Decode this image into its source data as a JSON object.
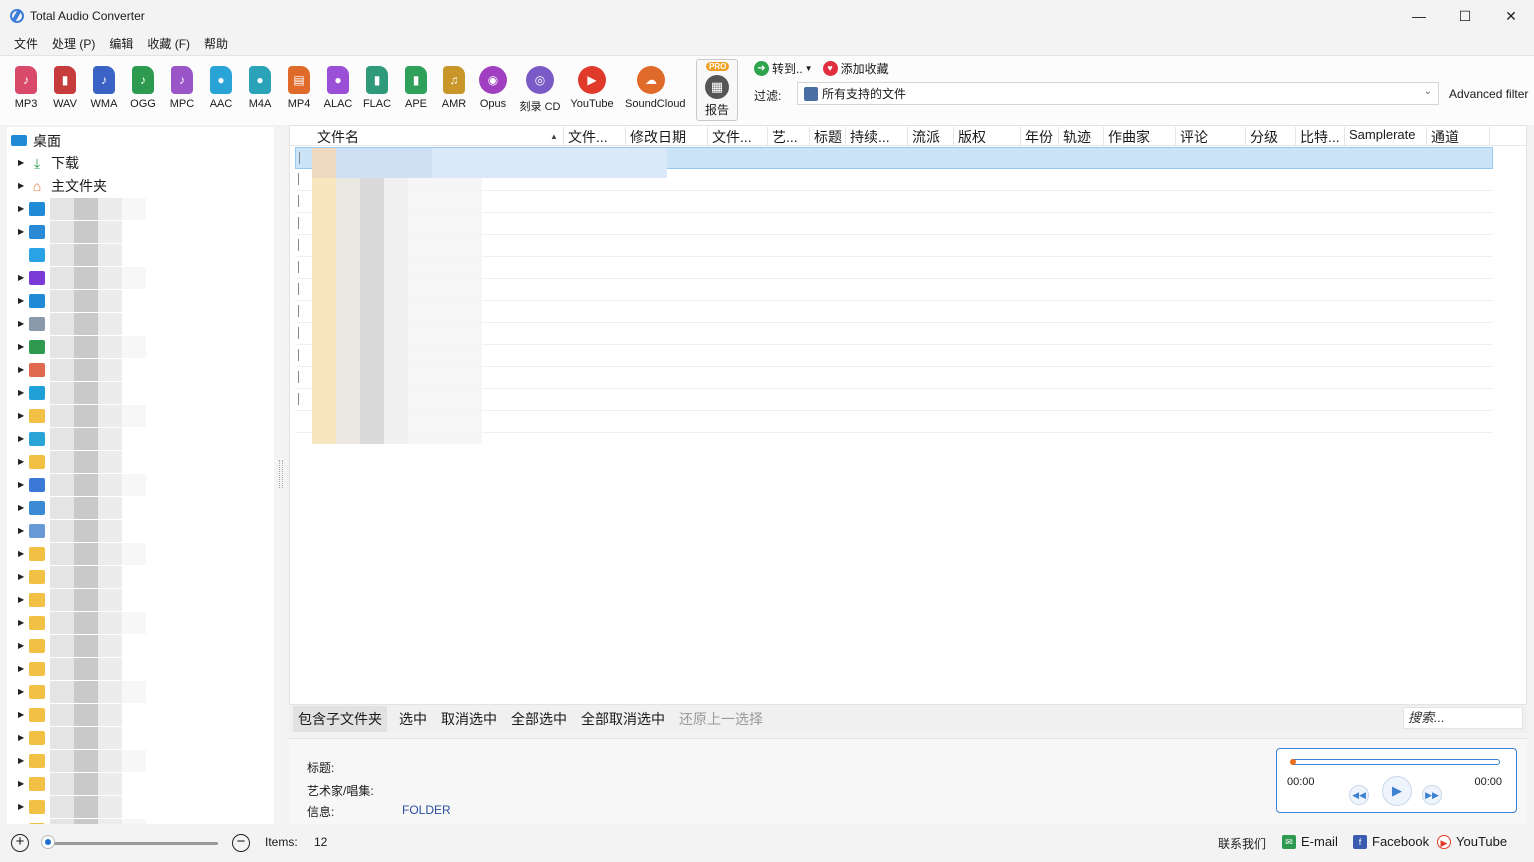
{
  "window": {
    "title": "Total Audio Converter",
    "minimize": "—",
    "maximize": "☐",
    "close": "✕"
  },
  "menu": [
    "文件",
    "处理 (P)",
    "编辑",
    "收藏 (F)",
    "帮助"
  ],
  "formats": [
    {
      "label": "MP3",
      "color": "#d94a6a",
      "glyph": "♪"
    },
    {
      "label": "WAV",
      "color": "#c63b3b",
      "glyph": "▮"
    },
    {
      "label": "WMA",
      "color": "#3b63c6",
      "glyph": "♪"
    },
    {
      "label": "OGG",
      "color": "#2e9a50",
      "glyph": "♪"
    },
    {
      "label": "MPC",
      "color": "#9a55c6",
      "glyph": "♪"
    },
    {
      "label": "AAC",
      "color": "#2aa3d6",
      "glyph": "●"
    },
    {
      "label": "M4A",
      "color": "#2aa3b8",
      "glyph": "●"
    },
    {
      "label": "MP4",
      "color": "#e06a2a",
      "glyph": "▤"
    },
    {
      "label": "ALAC",
      "color": "#9a4fd6",
      "glyph": "●"
    },
    {
      "label": "FLAC",
      "color": "#2e9a7a",
      "glyph": "▮"
    },
    {
      "label": "APE",
      "color": "#2ea05a",
      "glyph": "▮"
    },
    {
      "label": "AMR",
      "color": "#c9962a",
      "glyph": "♫"
    },
    {
      "label": "Opus",
      "color": "#a040c0",
      "glyph": "◉"
    },
    {
      "label": "刻录 CD",
      "color": "#7a5ac6",
      "glyph": "◎"
    },
    {
      "label": "YouTube",
      "color": "#e03a2a",
      "glyph": "▶"
    },
    {
      "label": "SoundCloud",
      "color": "#e06a2a",
      "glyph": "☁"
    }
  ],
  "report": {
    "pro": "PRO",
    "label": "报告"
  },
  "convert_to": "转到..",
  "add_favorite": "添加收藏",
  "filter": {
    "label": "过滤:",
    "value": "所有支持的文件",
    "advanced": "Advanced filter"
  },
  "tree": {
    "root": "桌面",
    "items": [
      {
        "label": "下载",
        "icon": "download-icon"
      },
      {
        "label": "主文件夹",
        "icon": "home-icon"
      }
    ]
  },
  "columns": [
    "文件名",
    "文件...",
    "修改日期",
    "文件...",
    "艺...",
    "标题",
    "持续...",
    "流派",
    "版权",
    "年份",
    "轨迹",
    "作曲家",
    "评论",
    "分级",
    "比特...",
    "Samplerate",
    "通道"
  ],
  "selection_bar": {
    "include_subfolders": "包含子文件夹",
    "select": "选中",
    "deselect": "取消选中",
    "select_all": "全部选中",
    "deselect_all": "全部取消选中",
    "restore": "还原上一选择",
    "search_placeholder": "搜索..."
  },
  "info": {
    "title_label": "标题:",
    "artist_label": "艺术家/唱集:",
    "info_label": "信息:",
    "info_value": "FOLDER"
  },
  "player": {
    "time_start": "00:00",
    "time_end": "00:00",
    "progress": 0
  },
  "status": {
    "items_label": "Items:",
    "items_count": "12",
    "contact": "联系我们",
    "email": "E-mail",
    "facebook": "Facebook",
    "youtube": "YouTube"
  }
}
